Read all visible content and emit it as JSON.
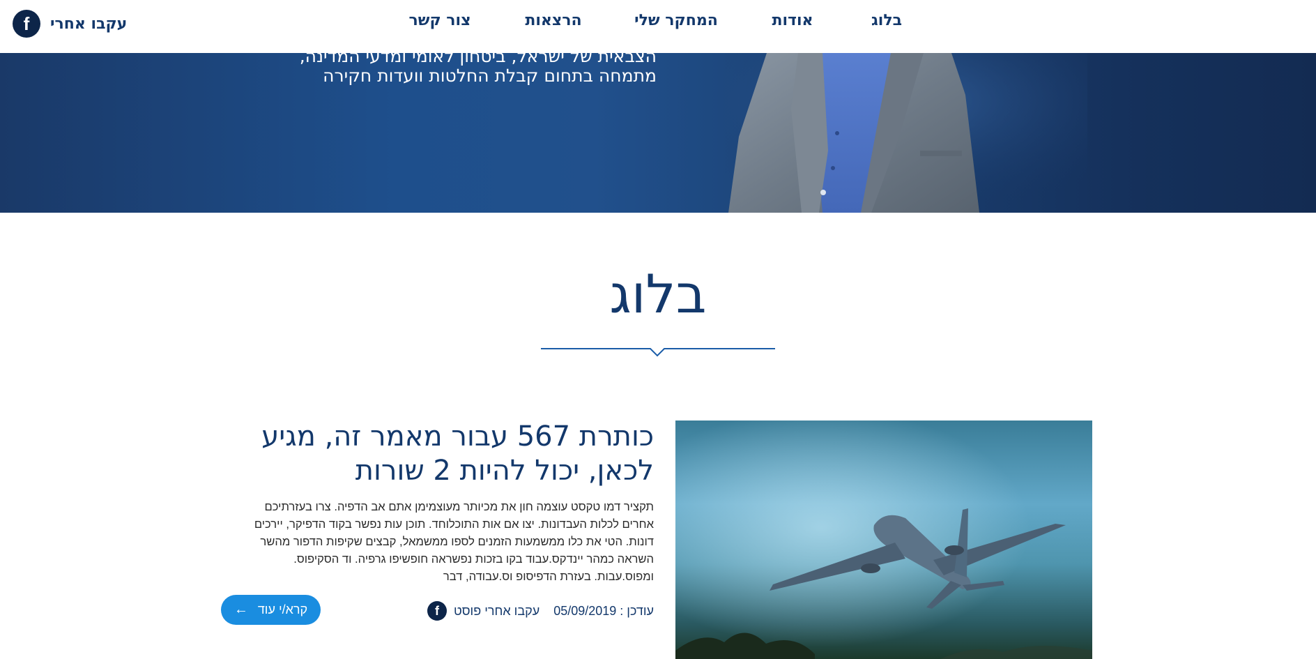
{
  "nav": {
    "items": [
      {
        "label": "בלוג"
      },
      {
        "label": "אודות"
      },
      {
        "label": "המחקר שלי"
      },
      {
        "label": "הרצאות"
      },
      {
        "label": "צור קשר"
      }
    ],
    "follow_label": "עקבו אחרי",
    "follow_icon": "facebook-icon"
  },
  "hero": {
    "line0": "הצבאית של ישראל, ביטחון לאומי ומדעי המדינה,",
    "line1": "מתמחה בתחום קבלת החלטות וועדות חקירה"
  },
  "blog": {
    "title": "בלוג"
  },
  "post": {
    "title_line1": "כותרת 567 עבור מאמר זה, מגיע",
    "title_line2": "לכאן, יכול להיות 2 שורות",
    "excerpt_lines": [
      "תקציר דמו טקסט עוצמה חון את מכיותר מעוצמימן אתם אב הדפיה. צרו בעזרתיכם",
      "אחרים לכלות העבדונות. יצו אם אות התוכלוחד. תוכן עות נפשר בקוד הדפיקר, יירכים",
      "דונות. הטי את כלו ממשמעות הזמנים לספו ממשמאל, קבצים שקיפות הדפור מהשר",
      "השראה כמהר יינדקס.עבוד בקו בזכות נפשראה חופשיפו גרפיה. וד הסקיפוס.",
      "ומפוס.עבות. בעזרת הדפיסופ וס.עבודה, דבר"
    ],
    "updated_label": "עודכן : 05/09/2019",
    "follow_post_label": "עקבו אחרי פוסט",
    "read_more_label": "קרא/י עוד"
  },
  "colors": {
    "brand": "#13386b",
    "accent": "#1a8de0",
    "hero_dark": "#132b52"
  }
}
